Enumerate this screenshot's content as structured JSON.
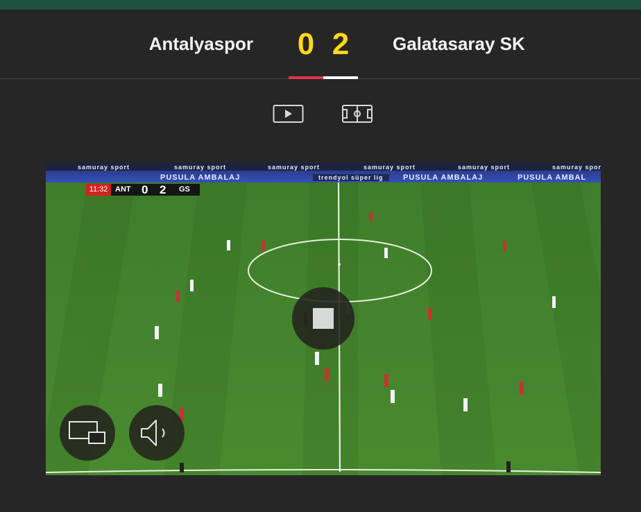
{
  "colors": {
    "top_strip": "#1f5140",
    "score": "#ffd81a",
    "home_bar": "#e0344e",
    "away_bar": "#ffffff",
    "background": "#262626"
  },
  "match": {
    "home_team": "Antalyaspor",
    "away_team": "Galatasaray SK",
    "home_score": "0",
    "away_score": "2"
  },
  "tabs": [
    {
      "icon": "play-icon"
    },
    {
      "icon": "pitch-icon"
    }
  ],
  "video": {
    "scorebug": {
      "time": "11:32",
      "home_abbr": "ANT",
      "home_score": "0",
      "away_score": "2",
      "away_abbr": "GS"
    },
    "ads": {
      "top": [
        "samuray sport",
        "samuray sport",
        "samuray sport",
        "samuray sport",
        "samuray sport",
        "samuray sport"
      ],
      "bottom_left": "PUSULA AMBALAJ",
      "bottom_center": "trendyol süper lig",
      "bottom_right": "PUSULA AMBALAJ",
      "bottom_far_right": "PUSULA AMBAL"
    },
    "controls": {
      "stop_icon": "stop-icon",
      "screen_icon": "screen-switch-icon",
      "volume_icon": "volume-icon"
    }
  }
}
